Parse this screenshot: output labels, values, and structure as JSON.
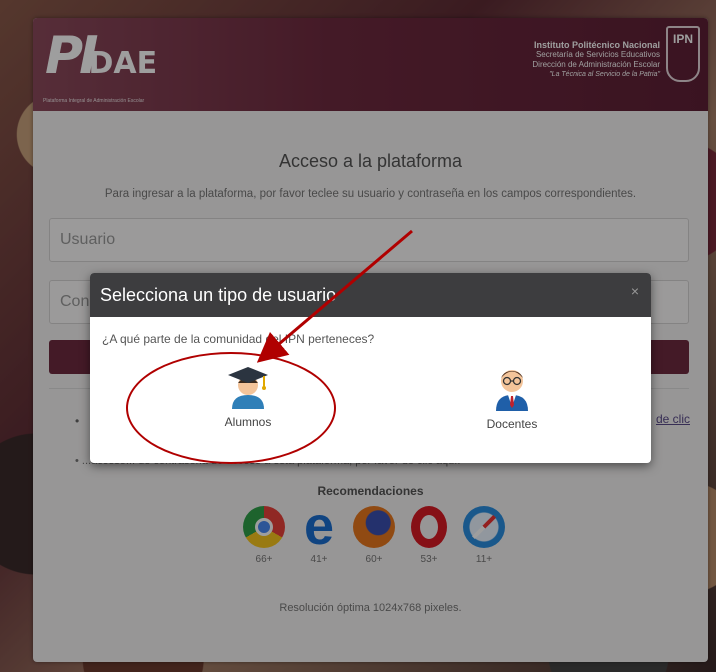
{
  "header": {
    "logo": "PIDAE",
    "logo_tagline": "Plataforma Integral de Administración Escolar",
    "institution_lines": [
      "Instituto Politécnico Nacional",
      "Secretaría de Servicios Educativos",
      "Dirección de Administración Escolar",
      "\"La Técnica al Servicio de la Patria\""
    ],
    "seal_text": "IPN"
  },
  "login": {
    "title": "Acceso a la plataforma",
    "subtitle": "Para ingresar a la plataforma, por favor teclee su usuario y contraseña en los campos correspondientes.",
    "user_placeholder": "Usuario",
    "password_placeholder_visible": "Con",
    "bullet1_prefix": "•",
    "link_right": "de clic",
    "bullet2": "• ...acceso... de contraseña de acceso a esta plataforma, por favor de clic aquí."
  },
  "recommendations": {
    "title": "Recomendaciones",
    "browsers": [
      {
        "name": "chrome-icon",
        "version": "66+",
        "color": "#e9413a"
      },
      {
        "name": "edge-icon",
        "version": "41+",
        "color": "#1a6fd1"
      },
      {
        "name": "firefox-icon",
        "version": "60+",
        "color": "#e8781d"
      },
      {
        "name": "opera-icon",
        "version": "53+",
        "color": "#d91a24"
      },
      {
        "name": "safari-icon",
        "version": "11+",
        "color": "#2a8fe0"
      }
    ],
    "resolution": "Resolución óptima 1024x768 pixeles."
  },
  "modal": {
    "title": "Selecciona un tipo de usuario",
    "close": "×",
    "question": "¿A qué parte de la comunidad del IPN perteneces?",
    "options": [
      {
        "label": "Alumnos",
        "icon": "graduate-icon"
      },
      {
        "label": "Docentes",
        "icon": "teacher-icon"
      }
    ]
  },
  "annotation": {
    "color": "#b00000"
  }
}
